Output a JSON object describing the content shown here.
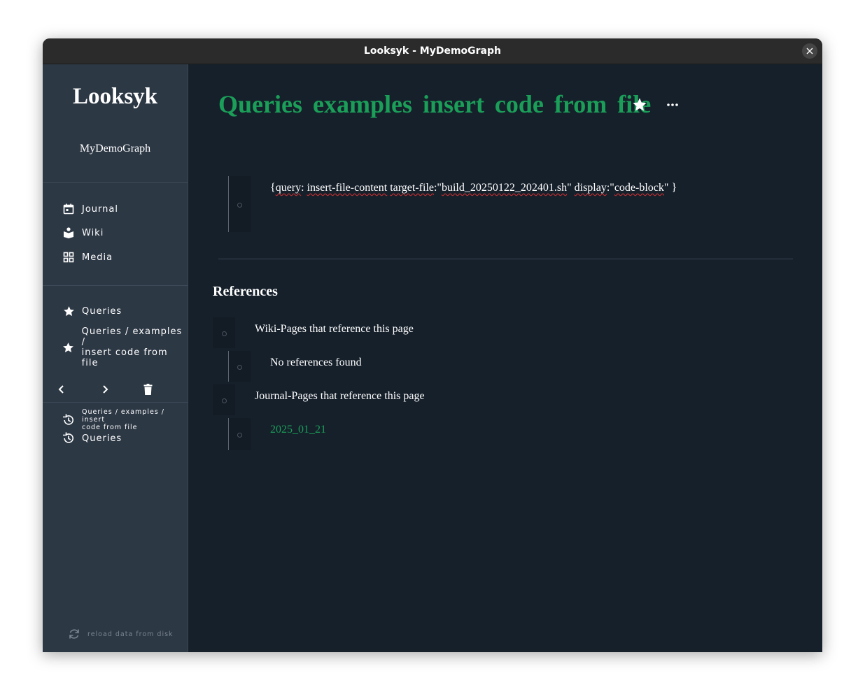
{
  "window": {
    "title": "Looksyk - MyDemoGraph"
  },
  "sidebar": {
    "brand": "Looksyk",
    "graph_name": "MyDemoGraph",
    "nav": [
      {
        "label": "Journal",
        "icon": "calendar-icon"
      },
      {
        "label": "Wiki",
        "icon": "book-reader-icon"
      },
      {
        "label": "Media",
        "icon": "grid-icon"
      }
    ],
    "favorites": [
      {
        "label": "Queries",
        "icon": "star-icon"
      },
      {
        "label_line1": "Queries / examples /",
        "label_line2": "insert code from file",
        "icon": "star-icon"
      }
    ],
    "history": [
      {
        "label_line1": "Queries / examples / insert",
        "label_line2": "code from file",
        "icon": "history-icon"
      },
      {
        "label": "Queries",
        "icon": "history-icon"
      }
    ],
    "reload_label": "reload data from disk"
  },
  "page": {
    "title": "Queries  examples  insert code from file",
    "block": {
      "prefix": "{",
      "segments": [
        {
          "text": "query",
          "wavy": true
        },
        {
          "text": ": ",
          "wavy": false
        },
        {
          "text": "insert-file-content",
          "wavy": true
        },
        {
          "text": " ",
          "wavy": false
        },
        {
          "text": "target-file",
          "wavy": true
        },
        {
          "text": ":\"",
          "wavy": false
        },
        {
          "text": "build_20250122_202401.sh",
          "wavy": true
        },
        {
          "text": "\" ",
          "wavy": false
        },
        {
          "text": "display",
          "wavy": true
        },
        {
          "text": ":\"",
          "wavy": false
        },
        {
          "text": "code-block",
          "wavy": true
        },
        {
          "text": "\" }",
          "wavy": false
        }
      ]
    },
    "references": {
      "heading": "References",
      "wiki_label": "Wiki-Pages that reference this page",
      "wiki_empty": "No references found",
      "journal_label": "Journal-Pages that reference this page",
      "journal_link": "2025_01_21"
    }
  },
  "colors": {
    "accent": "#1a9e58",
    "sidebar_bg": "#2d3845",
    "main_bg": "#16202b",
    "titlebar_bg": "#2b2b2b"
  }
}
